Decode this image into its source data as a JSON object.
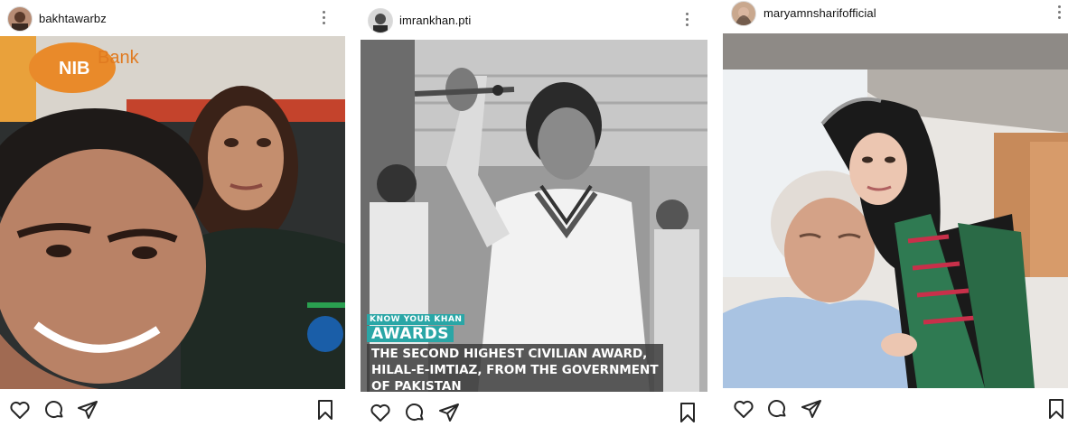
{
  "posts": [
    {
      "username": "bakhtawarbz",
      "photo_text": "NIB Bank",
      "icons": [
        "avatar",
        "more-icon",
        "heart-icon",
        "comment-icon",
        "share-icon",
        "bookmark-icon"
      ]
    },
    {
      "username": "imrankhan.pti",
      "overlay": {
        "kicker": "KNOW YOUR KHAN",
        "heading": "AWARDS",
        "text": "THE SECOND HIGHEST CIVILIAN AWARD, HILAL-E-IMTIAZ, FROM THE GOVERNMENT OF PAKISTAN"
      },
      "accent_color": "#2aa6a6",
      "icons": [
        "avatar",
        "more-icon",
        "heart-icon",
        "comment-icon",
        "share-icon",
        "bookmark-icon"
      ]
    },
    {
      "username": "maryamnsharifofficial",
      "icons": [
        "avatar",
        "more-icon",
        "heart-icon",
        "comment-icon",
        "share-icon",
        "bookmark-icon"
      ]
    }
  ]
}
